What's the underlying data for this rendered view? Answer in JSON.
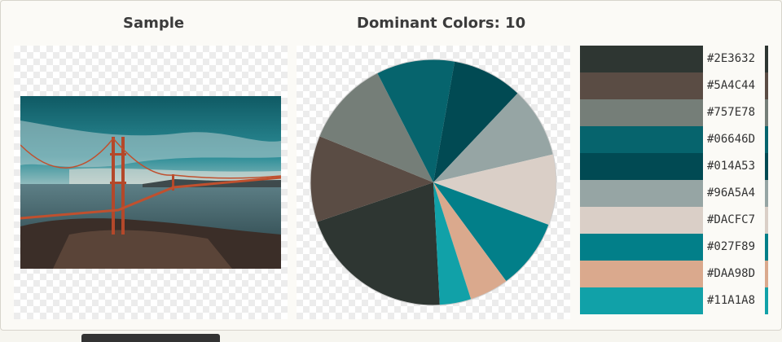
{
  "sample_heading": "Sample",
  "colors_heading": "Dominant Colors: 10",
  "colors": [
    {
      "hex": "#2E3632",
      "share": 0.2
    },
    {
      "hex": "#5A4C44",
      "share": 0.11
    },
    {
      "hex": "#757E78",
      "share": 0.11
    },
    {
      "hex": "#06646D",
      "share": 0.1
    },
    {
      "hex": "#014A53",
      "share": 0.09
    },
    {
      "hex": "#96A5A4",
      "share": 0.09
    },
    {
      "hex": "#DACFC7",
      "share": 0.09
    },
    {
      "hex": "#027F89",
      "share": 0.09
    },
    {
      "hex": "#DAA98D",
      "share": 0.05
    },
    {
      "hex": "#11A1A8",
      "share": 0.04
    }
  ]
}
